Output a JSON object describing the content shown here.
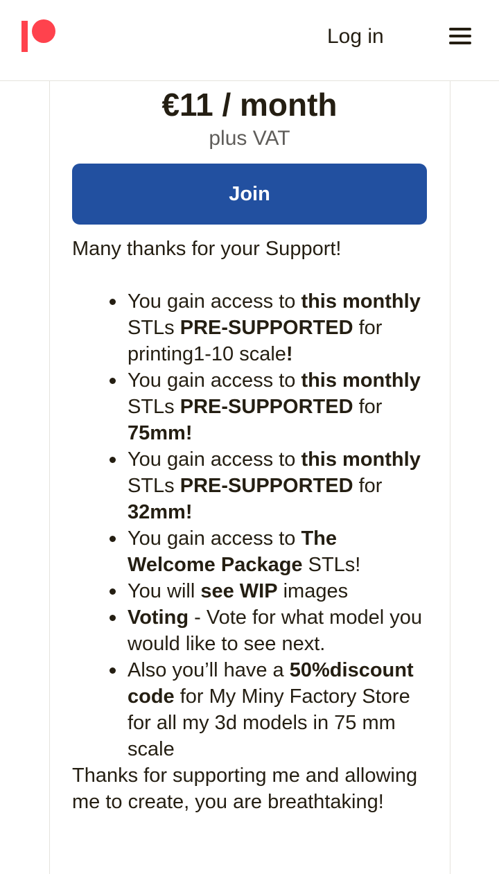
{
  "header": {
    "logo_icon": "patreon-logo-icon",
    "login_label": "Log in",
    "menu_icon": "hamburger-menu-icon"
  },
  "tier": {
    "price": "€11 / month",
    "vat_note": "plus VAT",
    "join_label": "Join",
    "intro": "Many thanks for your Support!",
    "benefits": [
      {
        "b1_t1": "You gain access to ",
        "b1_b1": "this monthly",
        "b1_t2": " STLs ",
        "b1_b2": "PRE-SUPPORTED",
        "b1_t3": " for printing1-10 scale",
        "b1_b3": "!"
      },
      {
        "b2_t1": "You gain access to ",
        "b2_b1": "this monthly",
        "b2_t2": " STLs ",
        "b2_b2": "PRE-SUPPORTED",
        "b2_t3": " for ",
        "b2_b3": "75mm!"
      },
      {
        "b3_t1": "You gain access to ",
        "b3_b1": "this monthly",
        "b3_t2": " STLs ",
        "b3_b2": "PRE-SUPPORTED",
        "b3_t3": " for ",
        "b3_b3": "32mm!"
      },
      {
        "b4_t1": "You gain access to ",
        "b4_b1": "The Welcome Package",
        "b4_t2": " STLs!"
      },
      {
        "b5_t1": "You will ",
        "b5_b1": "see WIP",
        "b5_t2": " images"
      },
      {
        "b6_b1": "Voting",
        "b6_t1": " - Vote for what model you would like to see next."
      },
      {
        "b7_t1": "Also you’ll have a ",
        "b7_b1": "50%discount code",
        "b7_t2": " for My Miny Factory Store for all my 3d models in 75 mm scale"
      }
    ],
    "outro": "Thanks for supporting me and allowing me to create, you are breathtaking!"
  },
  "colors": {
    "brand": "#ff424d",
    "button": "#2250a0",
    "text": "#241e12"
  }
}
